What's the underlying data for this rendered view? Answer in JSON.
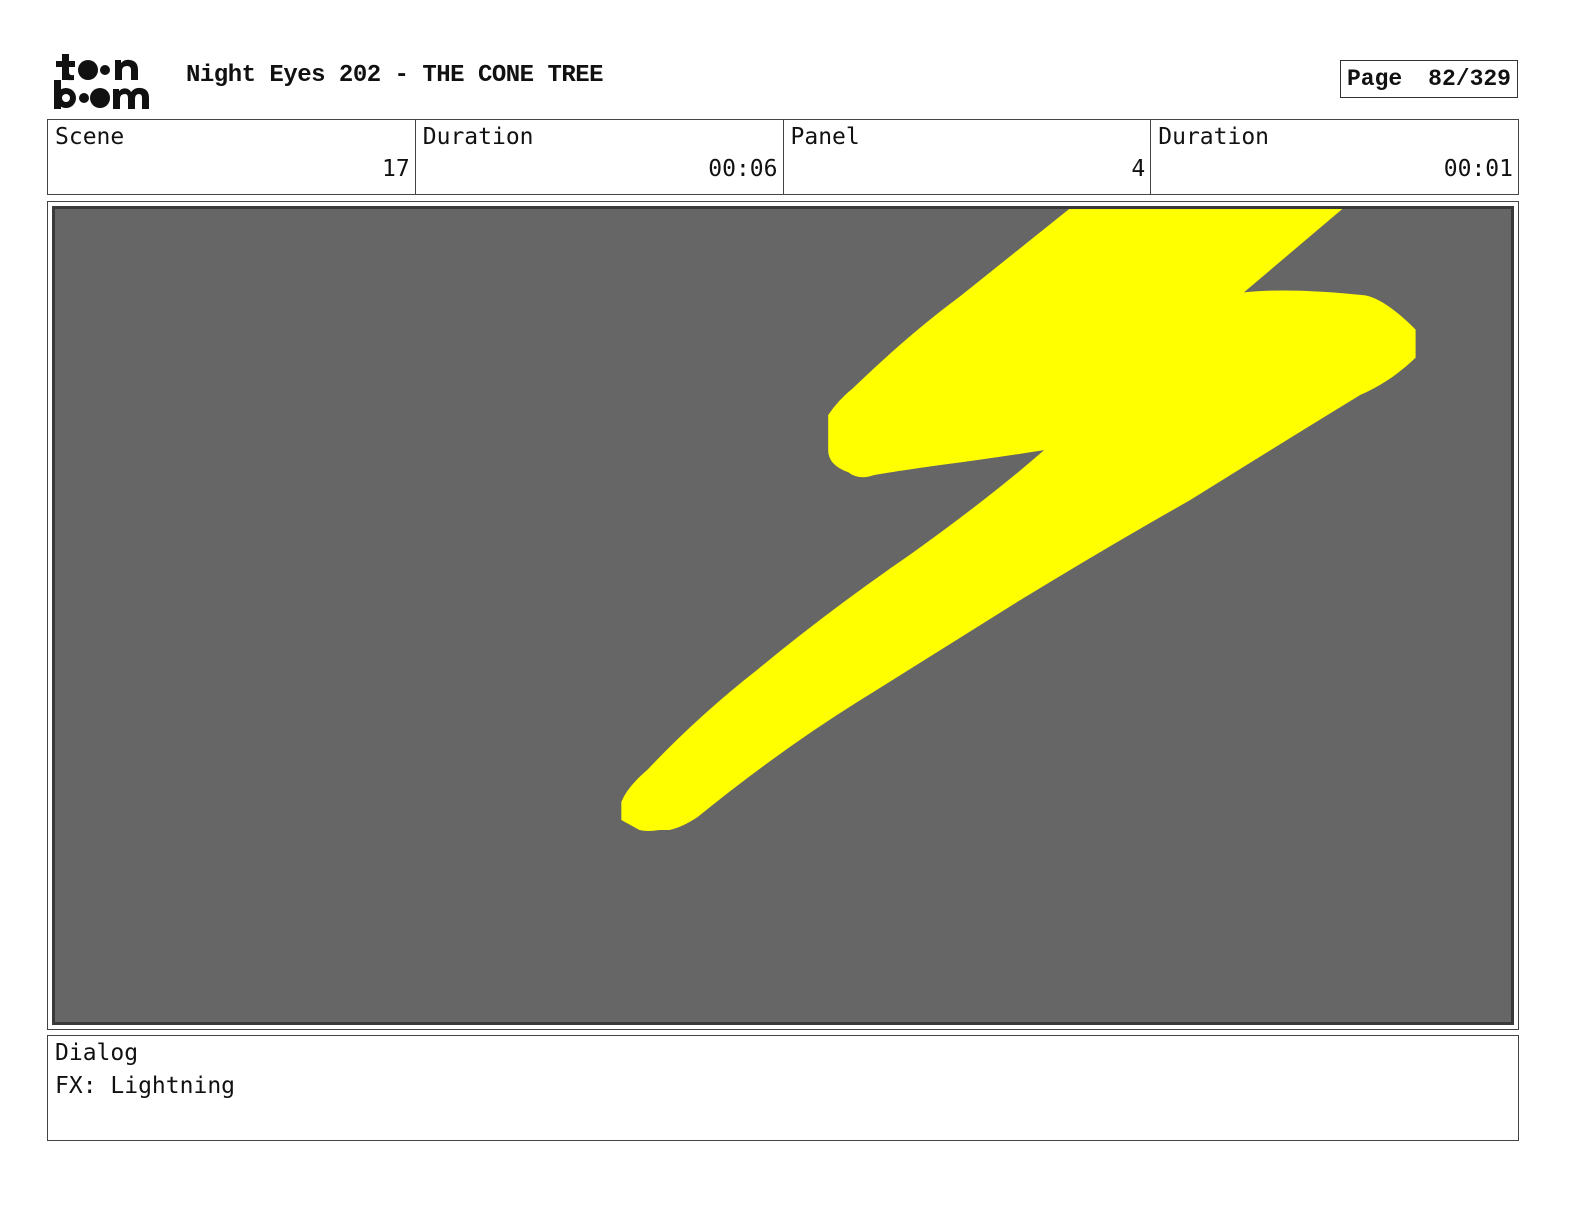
{
  "header": {
    "logo_text": "toon boom",
    "title": "Night Eyes 202 - THE CONE TREE",
    "page_label": "Page",
    "page_value": "82/329"
  },
  "info": {
    "scene_label": "Scene",
    "scene_value": "17",
    "scene_duration_label": "Duration",
    "scene_duration_value": "00:06",
    "panel_label": "Panel",
    "panel_value": "4",
    "panel_duration_label": "Duration",
    "panel_duration_value": "00:01"
  },
  "panel": {
    "background_color": "#666666",
    "lightning_color": "#ffff00",
    "icon": "lightning-bolt"
  },
  "dialog": {
    "label": "Dialog",
    "text": "FX: Lightning"
  }
}
